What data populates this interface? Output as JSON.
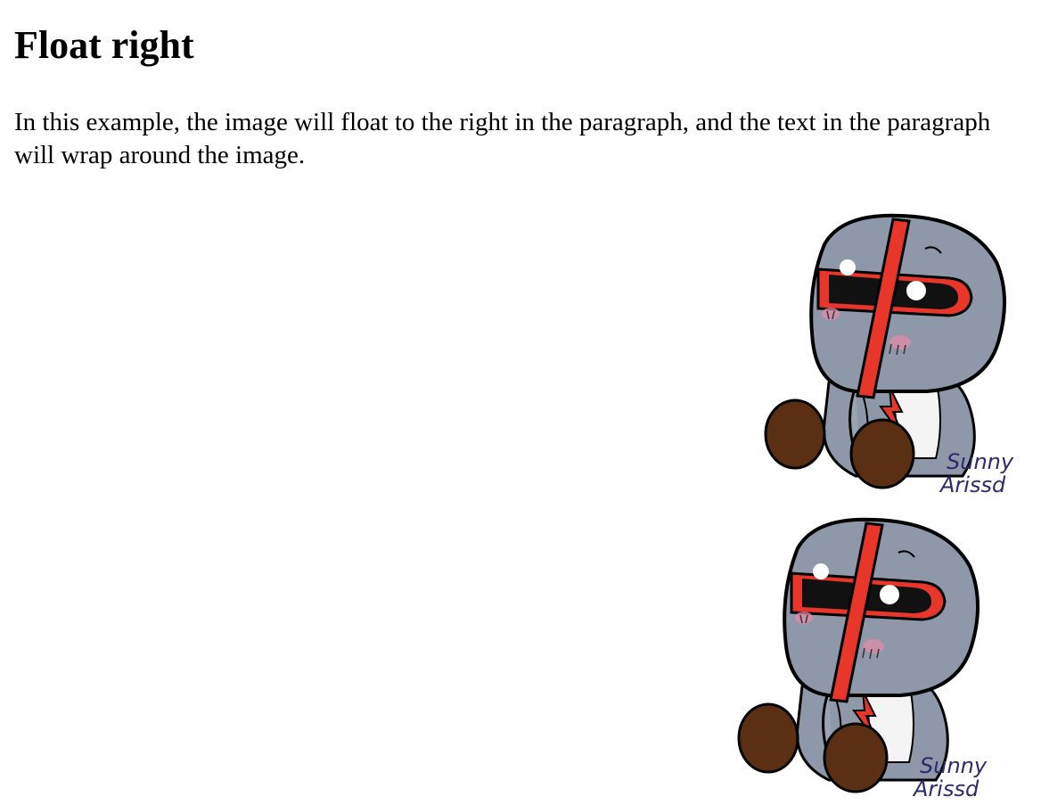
{
  "page": {
    "heading": "Float right",
    "paragraph": "In this example, the image will float to the right in the paragraph, and the text in the paragraph will wrap around the image."
  },
  "images": [
    {
      "signature_line1": "Sunny",
      "signature_line2": "Arissd"
    },
    {
      "signature_line1": "Sunny",
      "signature_line2": "Arissd"
    }
  ],
  "colors": {
    "robot_gray": "#8e98a8",
    "visor_red": "#e8362a",
    "visor_black": "#111111",
    "boot_brown": "#5a2f14",
    "blush": "#e88aa8",
    "signature": "#2b2b6e"
  }
}
